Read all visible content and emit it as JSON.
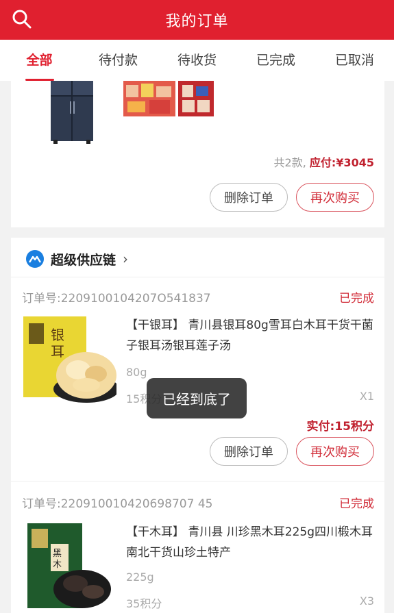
{
  "header": {
    "title": "我的订单",
    "search_icon": "search-icon"
  },
  "tabs": [
    {
      "label": "全部",
      "active": true
    },
    {
      "label": "待付款",
      "active": false
    },
    {
      "label": "待收货",
      "active": false
    },
    {
      "label": "已完成",
      "active": false
    },
    {
      "label": "已取消",
      "active": false
    }
  ],
  "order1": {
    "summary_count": "共2款,",
    "summary_due_label": "应付:",
    "summary_due_value": "¥3045",
    "delete_label": "删除订单",
    "rebuy_label": "再次购买"
  },
  "supplier": {
    "name": "超级供应链",
    "icon": "supplier-logo-icon"
  },
  "order2": {
    "order_no_label": "订单号:",
    "order_no": "2209100104207O541837",
    "status": "已完成",
    "product_title": "【干银耳】 青川县银耳80g雪耳白木耳干货干菌子银耳汤银耳莲子汤",
    "spec": "80g",
    "points": "15积分",
    "qty": "X1",
    "paid": "实付:15积分",
    "delete_label": "删除订单",
    "rebuy_label": "再次购买"
  },
  "order3": {
    "order_no_label": "订单号:",
    "order_no": "220910010420698707 45",
    "status": "已完成",
    "product_title": "【干木耳】 青川县 川珍黑木耳225g四川椴木耳南北干货山珍土特产",
    "spec": "225g",
    "points": "35积分",
    "qty": "X3"
  },
  "toast": "已经到底了",
  "colors": {
    "brand": "#e0202f",
    "price": "#c0202e"
  }
}
